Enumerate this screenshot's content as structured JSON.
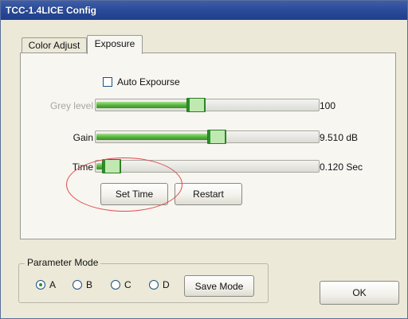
{
  "window": {
    "title": "TCC-1.4LICE Config"
  },
  "tabs": [
    {
      "label": "Color Adjust",
      "active": false
    },
    {
      "label": "Exposure",
      "active": true
    }
  ],
  "exposure": {
    "auto_exposure": {
      "label": "Auto Expourse",
      "checked": false
    },
    "grey_level": {
      "label": "Grey level",
      "value_text": "100",
      "position": 0.45,
      "enabled": false
    },
    "gain": {
      "label": "Gain",
      "value_text": "9.510 dB",
      "position": 0.55,
      "enabled": true
    },
    "time": {
      "label": "Time",
      "value_text": "0.120 Sec",
      "position": 0.03,
      "enabled": true
    },
    "set_time_label": "Set Time",
    "restart_label": "Restart"
  },
  "parameter_mode": {
    "title": "Parameter Mode",
    "options": [
      "A",
      "B",
      "C",
      "D"
    ],
    "selected": "A",
    "save_label": "Save Mode"
  },
  "ok_label": "OK",
  "colors": {
    "accent_green": "#54b33a",
    "highlight_circle": "#e2474e",
    "title_blue": "#2b4c9a"
  }
}
